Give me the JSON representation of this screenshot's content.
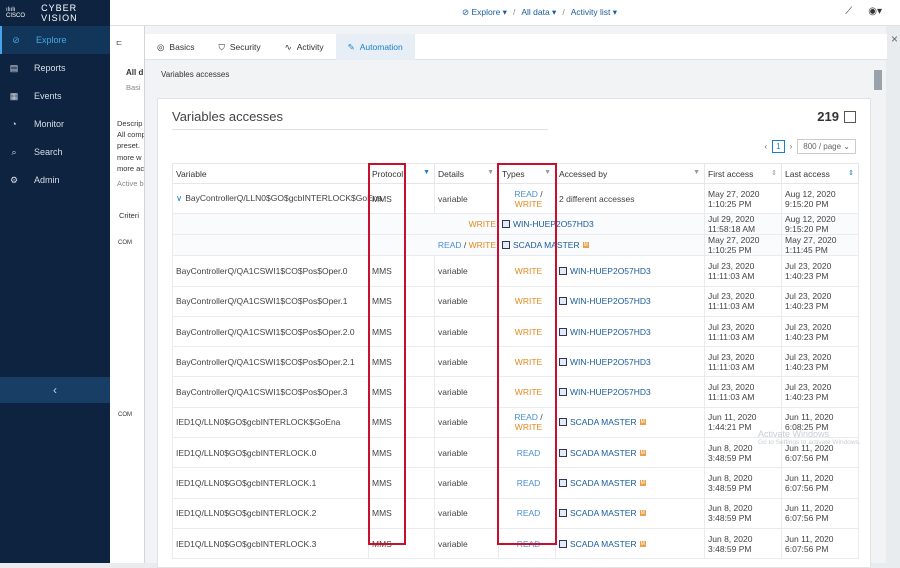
{
  "brand": {
    "mark": "ılıılı CISCO",
    "name": "CYBER VISION"
  },
  "nav": [
    {
      "label": "Explore",
      "icon": "compass-icon",
      "glyph": "⊘",
      "active": true
    },
    {
      "label": "Reports",
      "icon": "report-icon",
      "glyph": "▤"
    },
    {
      "label": "Events",
      "icon": "calendar-icon",
      "glyph": "▦"
    },
    {
      "label": "Monitor",
      "icon": "monitor-icon",
      "glyph": "◔"
    },
    {
      "label": "Search",
      "icon": "search-icon",
      "glyph": "⌕"
    },
    {
      "label": "Admin",
      "icon": "gear-icon",
      "glyph": "⚙"
    }
  ],
  "collapse": "‹",
  "breadcrumb": {
    "explore": "Explore",
    "all_data": "All data",
    "activity_list": "Activity list"
  },
  "background_text": {
    "title": "All d",
    "basi": "Basi",
    "descr": "Descrip",
    "allcom": "All comp",
    "preset": "preset.",
    "morew": "more w",
    "moreac": "more ac",
    "active": "Active b",
    "criteria": "Criteri",
    "com1": "COM",
    "com2": "COM"
  },
  "tabs": [
    {
      "label": "Basics",
      "icon": "camera-icon",
      "glyph": "◎"
    },
    {
      "label": "Security",
      "icon": "shield-icon",
      "glyph": "⛉"
    },
    {
      "label": "Activity",
      "icon": "activity-icon",
      "glyph": "∿"
    },
    {
      "label": "Automation",
      "icon": "wrench-icon",
      "glyph": "✎",
      "active": true
    }
  ],
  "close": "×",
  "subtitle": "Variables accesses",
  "card": {
    "title": "Variables accesses",
    "total": "219",
    "page": "1",
    "page_size": "800 / page"
  },
  "columns": [
    "Variable",
    "Protocol",
    "Details",
    "Types",
    "Accessed by",
    "First access",
    "Last access"
  ],
  "rows": [
    {
      "variable": "BayControllerQ/LLN0$GO$gcbINTERLOCK$GoEna",
      "expanded": true,
      "protocol": "MMS",
      "details": "variable",
      "types": [
        "READ",
        "WRITE"
      ],
      "accessed": "2 different accesses",
      "first": "May 27, 2020 1:10:25 PM",
      "last": "Aug 12, 2020 9:15:20 PM"
    },
    {
      "sub": true,
      "types": [
        "WRITE"
      ],
      "accessed": "WIN-HUEP2O57HD3",
      "first": "Jul 29, 2020 11:58:18 AM",
      "last": "Aug 12, 2020 9:15:20 PM"
    },
    {
      "sub": true,
      "types": [
        "READ",
        "WRITE"
      ],
      "accessed": "SCADA MASTER",
      "tag": true,
      "first": "May 27, 2020 1:10:25 PM",
      "last": "May 27, 2020 1:11:45 PM"
    },
    {
      "variable": "BayControllerQ/QA1CSWI1$CO$Pos$Oper.0",
      "protocol": "MMS",
      "details": "variable",
      "types": [
        "WRITE"
      ],
      "accessed": "WIN-HUEP2O57HD3",
      "first": "Jul 23, 2020 11:11:03 AM",
      "last": "Jul 23, 2020 1:40:23 PM"
    },
    {
      "variable": "BayControllerQ/QA1CSWI1$CO$Pos$Oper.1",
      "protocol": "MMS",
      "details": "variable",
      "types": [
        "WRITE"
      ],
      "accessed": "WIN-HUEP2O57HD3",
      "first": "Jul 23, 2020 11:11:03 AM",
      "last": "Jul 23, 2020 1:40:23 PM"
    },
    {
      "variable": "BayControllerQ/QA1CSWI1$CO$Pos$Oper.2.0",
      "protocol": "MMS",
      "details": "variable",
      "types": [
        "WRITE"
      ],
      "accessed": "WIN-HUEP2O57HD3",
      "first": "Jul 23, 2020 11:11:03 AM",
      "last": "Jul 23, 2020 1:40:23 PM"
    },
    {
      "variable": "BayControllerQ/QA1CSWI1$CO$Pos$Oper.2.1",
      "protocol": "MMS",
      "details": "variable",
      "types": [
        "WRITE"
      ],
      "accessed": "WIN-HUEP2O57HD3",
      "first": "Jul 23, 2020 11:11:03 AM",
      "last": "Jul 23, 2020 1:40:23 PM"
    },
    {
      "variable": "BayControllerQ/QA1CSWI1$CO$Pos$Oper.3",
      "protocol": "MMS",
      "details": "variable",
      "types": [
        "WRITE"
      ],
      "accessed": "WIN-HUEP2O57HD3",
      "first": "Jul 23, 2020 11:11:03 AM",
      "last": "Jul 23, 2020 1:40:23 PM"
    },
    {
      "variable": "IED1Q/LLN0$GO$gcbINTERLOCK$GoEna",
      "protocol": "MMS",
      "details": "variable",
      "types": [
        "READ",
        "WRITE"
      ],
      "accessed": "SCADA MASTER",
      "tag": true,
      "first": "Jun 11, 2020 1:44:21 PM",
      "last": "Jun 11, 2020 6:08:25 PM"
    },
    {
      "variable": "IED1Q/LLN0$GO$gcbINTERLOCK.0",
      "protocol": "MMS",
      "details": "variable",
      "types": [
        "READ"
      ],
      "accessed": "SCADA MASTER",
      "tag": true,
      "first": "Jun 8, 2020 3:48:59 PM",
      "last": "Jun 11, 2020 6:07:56 PM"
    },
    {
      "variable": "IED1Q/LLN0$GO$gcbINTERLOCK.1",
      "protocol": "MMS",
      "details": "variable",
      "types": [
        "READ"
      ],
      "accessed": "SCADA MASTER",
      "tag": true,
      "first": "Jun 8, 2020 3:48:59 PM",
      "last": "Jun 11, 2020 6:07:56 PM"
    },
    {
      "variable": "IED1Q/LLN0$GO$gcbINTERLOCK.2",
      "protocol": "MMS",
      "details": "variable",
      "types": [
        "READ"
      ],
      "accessed": "SCADA MASTER",
      "tag": true,
      "first": "Jun 8, 2020 3:48:59 PM",
      "last": "Jun 11, 2020 6:07:56 PM"
    },
    {
      "variable": "IED1Q/LLN0$GO$gcbINTERLOCK.3",
      "protocol": "MMS",
      "details": "variable",
      "types": [
        "READ"
      ],
      "accessed": "SCADA MASTER",
      "tag": true,
      "first": "Jun 8, 2020 3:48:59 PM",
      "last": "Jun 11, 2020 6:07:56 PM"
    }
  ],
  "tag_text": "M",
  "watermark": {
    "title": "Activate Windows",
    "sub": "Go to Settings to activate Windows."
  },
  "colors": {
    "highlight": "#c8102e",
    "read": "#4a8fd0",
    "write": "#e08a1e",
    "sidebar": "#0d2340"
  }
}
